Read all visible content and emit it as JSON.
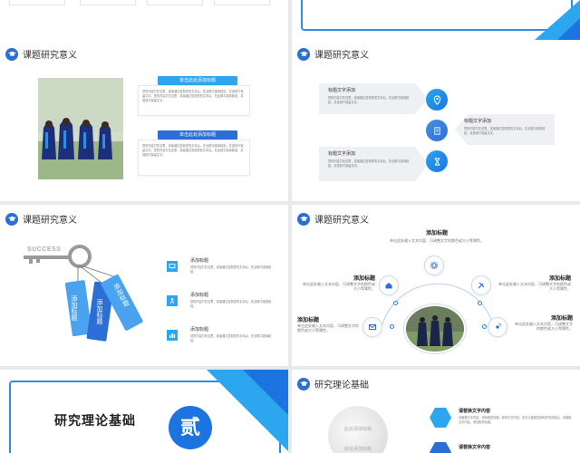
{
  "section_title": "课题研究意义",
  "section_title_2": "研究理论基础",
  "slide1": {
    "label1": "单击此处添加标题",
    "label2": "单击此处添加标题",
    "body1": "您的内容打在这里，或者通过复制您的文本后，在此框中选择粘贴，并选择只保留文字。您的内容打在这里，或者通过复制您的文本后，在此框中选择粘贴，并选择只保留文字。",
    "body2": "您的内容打在这里，或者通过复制您的文本后，在此框中选择粘贴，并选择只保留文字。您的内容打在这里，或者通过复制您的文本后，在此框中选择粘贴，并选择只保留文字。"
  },
  "slide2": {
    "item1_title": "标题文字添加",
    "item2_title": "标题文字添加",
    "item3_title": "标题文字添加",
    "body": "您的内容打在这里，或者通过复制您的文本后，在此框中选择粘贴，并选择只保留文字。"
  },
  "slide3": {
    "success_text": "SUCCESS",
    "tag1": "添加标题",
    "tag2": "添加标题",
    "tag3": "添加标题",
    "row1_title": "添加标题",
    "row2_title": "添加标题",
    "row3_title": "添加标题",
    "row_body": "您的内容打在这里，或者通过复制您的文本后，在此框中选择粘贴。"
  },
  "slide4": {
    "top_title": "添加标题",
    "top_body": "单击此处输入文本内容，可调整文字的颜色或大小等属性。",
    "left1_title": "添加标题",
    "left1_body": "单击此处输入文本内容，可调整文字的颜色或大小等属性。",
    "left2_title": "添加标题",
    "left2_body": "单击此处输入文本内容，可调整文字的颜色或大小等属性。",
    "right1_title": "添加标题",
    "right1_body": "单击此处输入文本内容，可调整文字的颜色或大小等属性。",
    "right2_title": "添加标题",
    "right2_body": "单击此处输入文本内容，可调整文字的颜色或大小等属性。"
  },
  "slide5": {
    "title": "研究理论基础",
    "number_char": "贰"
  },
  "slide6": {
    "item1_title": "请替换文字内容",
    "item1_body": "请替换文字内容，添加相关标题，修改文字内容，也可以直接复制你的内容到此。请替换文字内容，添加相关标题。",
    "item2_title": "请替换文字内容",
    "label_a": "此处添加标题",
    "label_b": "此处添加标题"
  },
  "colors": {
    "accent": "#2b6fd6",
    "accent_light": "#2ca6ee"
  }
}
